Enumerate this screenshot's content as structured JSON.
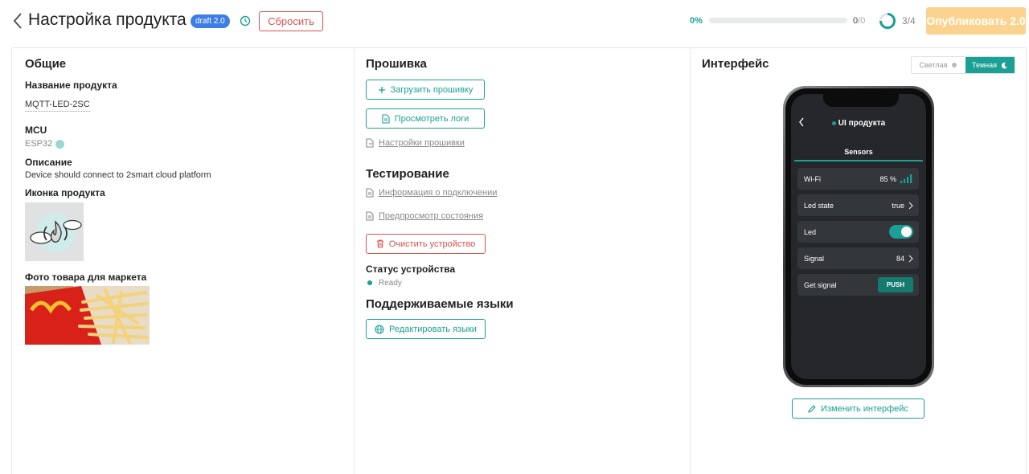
{
  "header": {
    "title": "Настройка продукта",
    "badge": "draft 2.0",
    "reset_label": "Сбросить",
    "progress_pct": "0%",
    "progress_value": 0,
    "count_done": "0",
    "count_sep": "/",
    "count_total": "0",
    "steps": "3/4",
    "publish_label": "Опубликовать 2.0"
  },
  "general": {
    "heading": "Общие",
    "name_label": "Название продукта",
    "name_value": "MQTT-LED-2SC",
    "mcu_label": "MCU",
    "mcu_value": "ESP32",
    "desc_label": "Описание",
    "desc_value": "Device should connect to 2smart cloud platform",
    "icon_label": "Иконка продукта",
    "photo_label": "Фото товара для маркета"
  },
  "firmware": {
    "heading": "Прошивка",
    "upload_label": "Загрузить прошивку",
    "logs_label": "Просмотреть логи",
    "settings_link": "Настройки прошивки",
    "testing_heading": "Тестирование",
    "conn_info_link": "Информация о подключении",
    "preview_link": "Предпросмотр состояния",
    "clear_label": "Очистить устройство",
    "status_label": "Статус устройства",
    "status_value": "Ready",
    "languages_heading": "Поддерживаемые языки",
    "edit_languages_label": "Редактировать языки"
  },
  "interface": {
    "heading": "Интерфейс",
    "theme_light": "Светлая",
    "theme_dark": "Темная",
    "edit_label": "Изменить интерфейс",
    "phone": {
      "title": "UI продукта",
      "tab": "Sensors",
      "rows": [
        {
          "label": "Wi-Fi",
          "value": "85 %"
        },
        {
          "label": "Led state",
          "value": "true"
        },
        {
          "label": "Led",
          "value": ""
        },
        {
          "label": "Signal",
          "value": "84"
        },
        {
          "label": "Get signal",
          "value": "PUSH"
        }
      ]
    }
  },
  "colors": {
    "accent": "#1ba095",
    "danger": "#d9534f",
    "badge": "#3d7ee6",
    "publish": "#fbd38e"
  }
}
